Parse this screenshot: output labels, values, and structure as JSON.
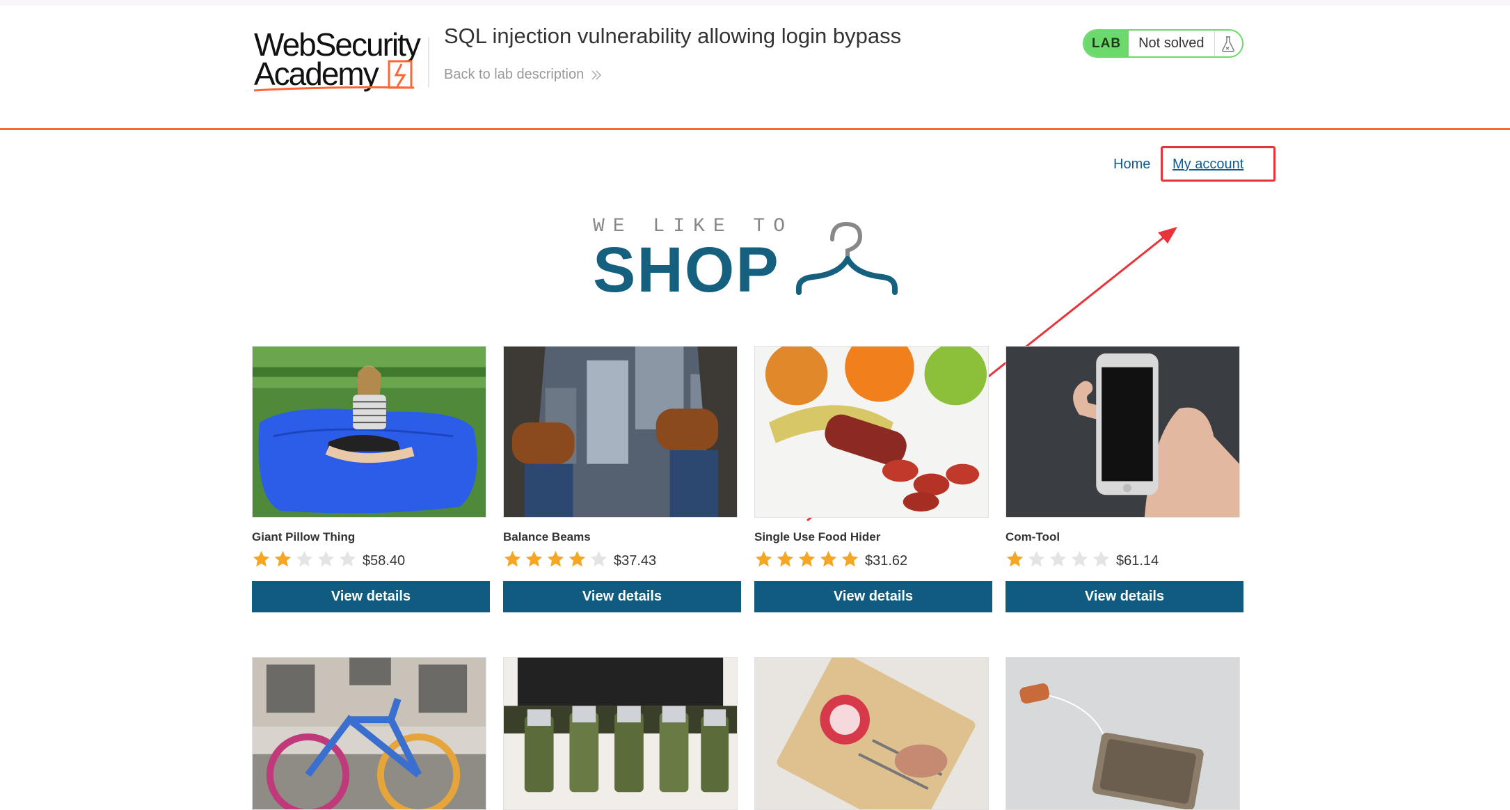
{
  "header": {
    "logo_alt": "Web Security Academy",
    "lab_title": "SQL injection vulnerability allowing login bypass",
    "back_link": "Back to lab description",
    "lab_tag": "LAB",
    "lab_status": "Not solved"
  },
  "nav": {
    "home": "Home",
    "my_account": "My account"
  },
  "banner": {
    "small": "WE LIKE TO",
    "big": "SHOP"
  },
  "products": [
    {
      "name": "Giant Pillow Thing",
      "rating": 2,
      "price": "$58.40",
      "button": "View details"
    },
    {
      "name": "Balance Beams",
      "rating": 4,
      "price": "$37.43",
      "button": "View details"
    },
    {
      "name": "Single Use Food Hider",
      "rating": 5,
      "price": "$31.62",
      "button": "View details"
    },
    {
      "name": "Com-Tool",
      "rating": 1,
      "price": "$61.14",
      "button": "View details"
    }
  ],
  "colors": {
    "accent": "#ff6633",
    "button": "#105c80",
    "link": "#0b5c99",
    "star": "#f5a623",
    "lab_badge": "#6cd96c",
    "annotation": "#e8333a"
  }
}
